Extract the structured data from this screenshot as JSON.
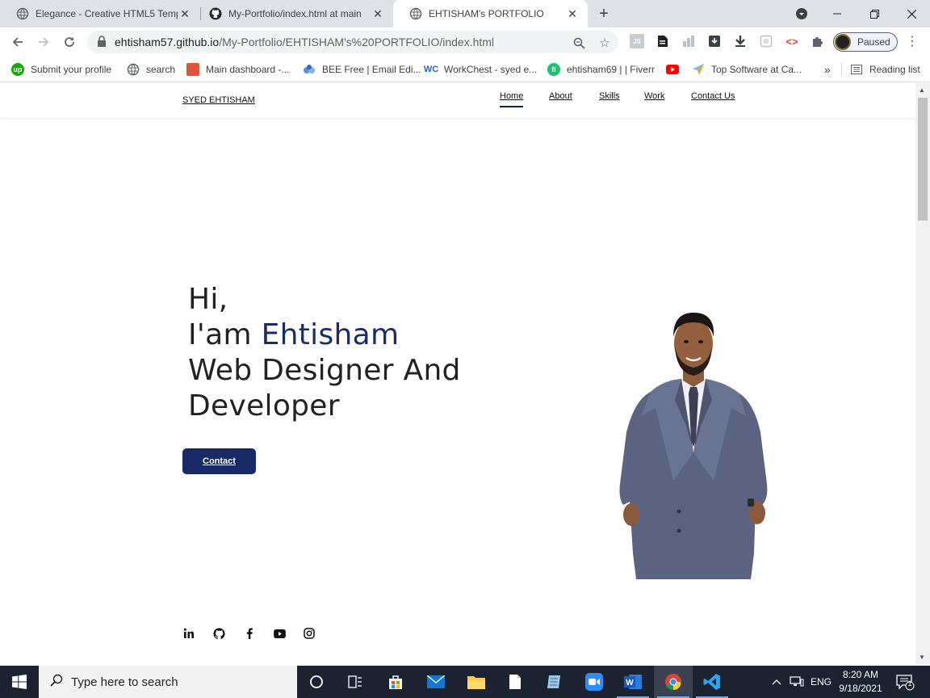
{
  "browser": {
    "tabs": [
      {
        "title": "Elegance - Creative HTML5 Temp",
        "active": false
      },
      {
        "title": "My-Portfolio/index.html at main",
        "active": false
      },
      {
        "title": "EHTISHAM's PORTFOLIO",
        "active": true
      }
    ],
    "url_host": "ehtisham57.github.io",
    "url_path": "/My-Portfolio/EHTISHAM's%20PORTFOLIO/index.html",
    "profile_status": "Paused",
    "bookmarks": [
      {
        "label": "Submit your profile",
        "icon": "upwork-icon"
      },
      {
        "label": "search",
        "icon": "globe-icon"
      },
      {
        "label": "Main dashboard -...",
        "icon": "dashboard-icon"
      },
      {
        "label": "BEE Free | Email Edi...",
        "icon": "bee-icon"
      },
      {
        "label": "WorkChest - syed e...",
        "icon": "workchest-icon"
      },
      {
        "label": "ehtisham69 | | Fiverr",
        "icon": "fiverr-icon"
      },
      {
        "label": "",
        "icon": "youtube-icon"
      },
      {
        "label": "Top Software at Ca...",
        "icon": "capterra-icon"
      }
    ],
    "bookmarks_overflow": "»",
    "reading_list": "Reading list"
  },
  "site": {
    "logo": "SYED EHTISHAM",
    "nav": [
      {
        "label": "Home",
        "active": true
      },
      {
        "label": "About",
        "active": false
      },
      {
        "label": "Skills",
        "active": false
      },
      {
        "label": "Work",
        "active": false
      },
      {
        "label": "Contact Us",
        "active": false
      }
    ],
    "hero": {
      "line1": "Hi,",
      "line2_prefix": "I'am ",
      "name": "Ehtisham",
      "line3": "Web Designer And",
      "line4": "Developer"
    },
    "contact_button": "Contact",
    "social": [
      "linkedin-icon",
      "github-icon",
      "facebook-icon",
      "youtube-icon",
      "instagram-icon"
    ],
    "colors": {
      "accent": "#172a66",
      "name": "#1a2c66"
    }
  },
  "taskbar": {
    "search_placeholder": "Type here to search",
    "language": "ENG",
    "time": "8:20 AM",
    "date": "9/18/2021",
    "notification_count": "1"
  }
}
